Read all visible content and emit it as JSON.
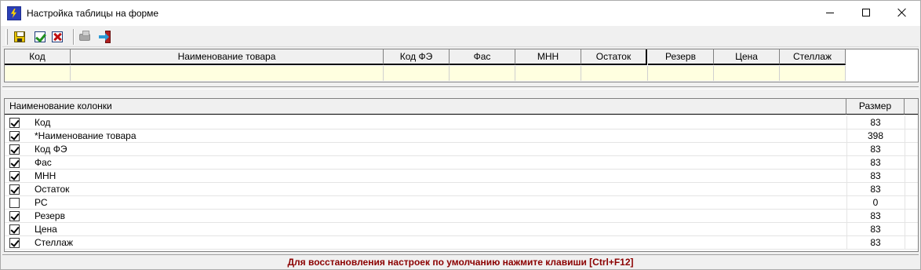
{
  "window": {
    "title": "Настройка таблицы на форме",
    "controls": {
      "minimize": "minimize-icon",
      "maximize": "maximize-icon",
      "close": "close-icon"
    }
  },
  "toolbar": {
    "buttons": [
      {
        "icon": "save-icon",
        "enabled": true
      },
      {
        "icon": "checkmark-icon",
        "enabled": true
      },
      {
        "icon": "cancel-icon",
        "enabled": true
      },
      {
        "icon": "print-icon",
        "enabled": false
      },
      {
        "icon": "exit-door-icon",
        "enabled": true
      }
    ]
  },
  "preview": {
    "columns": [
      "Код",
      "Наименование товара",
      "Код ФЭ",
      "Фас",
      "МНН",
      "Остаток",
      "Резерв",
      "Цена",
      "Стеллаж"
    ]
  },
  "columns_list": {
    "header_name": "Наименование колонки",
    "header_size": "Размер",
    "rows": [
      {
        "checked": true,
        "name": "Код",
        "size": "83"
      },
      {
        "checked": true,
        "name": "*Наименование товара",
        "size": "398"
      },
      {
        "checked": true,
        "name": "Код ФЭ",
        "size": "83"
      },
      {
        "checked": true,
        "name": "Фас",
        "size": "83"
      },
      {
        "checked": true,
        "name": "МНН",
        "size": "83"
      },
      {
        "checked": true,
        "name": "Остаток",
        "size": "83"
      },
      {
        "checked": false,
        "name": "РС",
        "size": "0"
      },
      {
        "checked": true,
        "name": "Резерв",
        "size": "83"
      },
      {
        "checked": true,
        "name": "Цена",
        "size": "83"
      },
      {
        "checked": true,
        "name": "Стеллаж",
        "size": "83"
      }
    ]
  },
  "status": {
    "text": "Для восстановления настроек по умолчанию нажмите клавиши [Ctrl+F12]",
    "color": "#8b0000"
  },
  "colors": {
    "preview_row_bg": "#ffffe0",
    "window_bg": "#f0f0f0"
  }
}
